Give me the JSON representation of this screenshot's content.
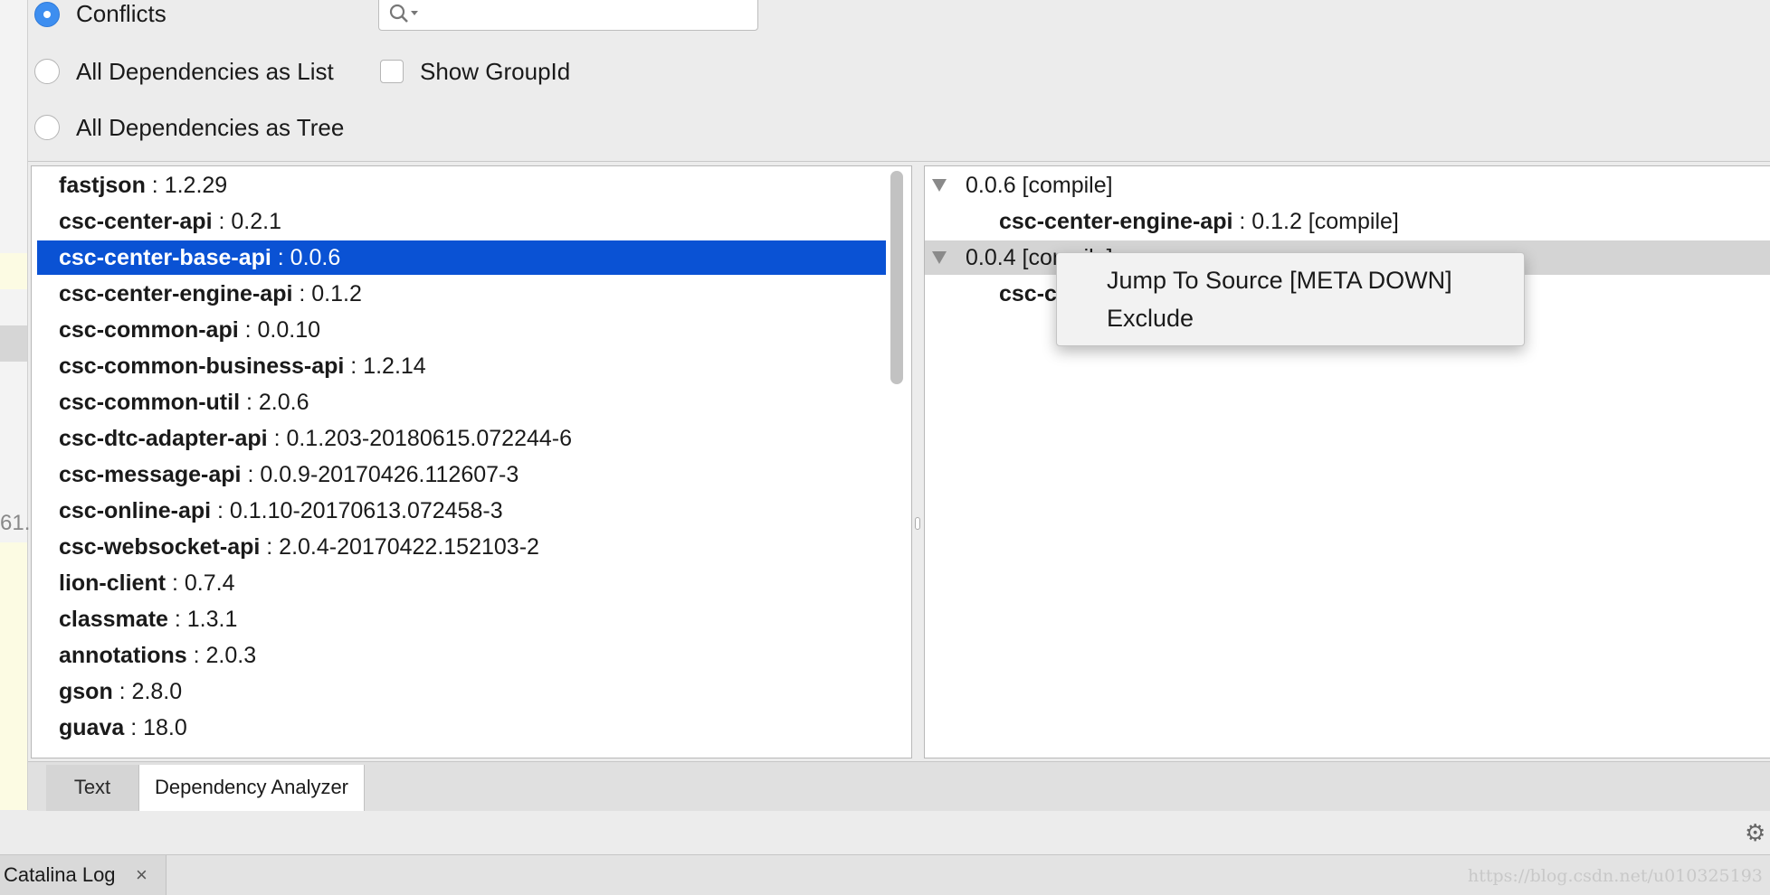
{
  "options": {
    "conflicts_label": "Conflicts",
    "list_label": "All Dependencies as List",
    "tree_label": "All Dependencies as Tree",
    "show_groupid_label": "Show GroupId",
    "selected_mode": "Conflicts",
    "show_groupid_checked": false,
    "search_value": ""
  },
  "dependency_list": [
    {
      "name": "fastjson",
      "version": " : 1.2.29"
    },
    {
      "name": "csc-center-api",
      "version": " : 0.2.1"
    },
    {
      "name": "csc-center-base-api",
      "version": " : 0.0.6",
      "selected": true
    },
    {
      "name": "csc-center-engine-api",
      "version": " : 0.1.2"
    },
    {
      "name": "csc-common-api",
      "version": " : 0.0.10"
    },
    {
      "name": "csc-common-business-api",
      "version": " : 1.2.14"
    },
    {
      "name": "csc-common-util",
      "version": " : 2.0.6"
    },
    {
      "name": "csc-dtc-adapter-api",
      "version": " : 0.1.203-20180615.072244-6"
    },
    {
      "name": "csc-message-api",
      "version": " : 0.0.9-20170426.112607-3"
    },
    {
      "name": "csc-online-api",
      "version": " : 0.1.10-20170613.072458-3"
    },
    {
      "name": "csc-websocket-api",
      "version": " : 2.0.4-20170422.152103-2"
    },
    {
      "name": "lion-client",
      "version": " : 0.7.4"
    },
    {
      "name": "classmate",
      "version": " : 1.3.1"
    },
    {
      "name": "annotations",
      "version": " : 2.0.3"
    },
    {
      "name": "gson",
      "version": " : 2.8.0"
    },
    {
      "name": "guava",
      "version": " : 18.0"
    }
  ],
  "tree": {
    "node1": {
      "label": "0.0.6 [compile]",
      "child_name": "csc-center-engine-api",
      "child_version": " : 0.1.2 [compile]"
    },
    "node2": {
      "label": "0.0.4 [compile]",
      "child_name": "csc-c"
    }
  },
  "context_menu": {
    "jump_to_source": "Jump To Source [META DOWN]",
    "exclude": "Exclude"
  },
  "tabs": {
    "text": "Text",
    "dependency_analyzer": "Dependency Analyzer",
    "active": "Dependency Analyzer"
  },
  "bottom": {
    "catalina_log": "Catalina Log",
    "close_glyph": "×",
    "gutter_text": "61.",
    "watermark": "https://blog.csdn.net/u010325193"
  },
  "colors": {
    "selection": "#0a52d4",
    "radio_selected": "#3d8ef0",
    "tree_highlight": "#d4d4d4"
  }
}
